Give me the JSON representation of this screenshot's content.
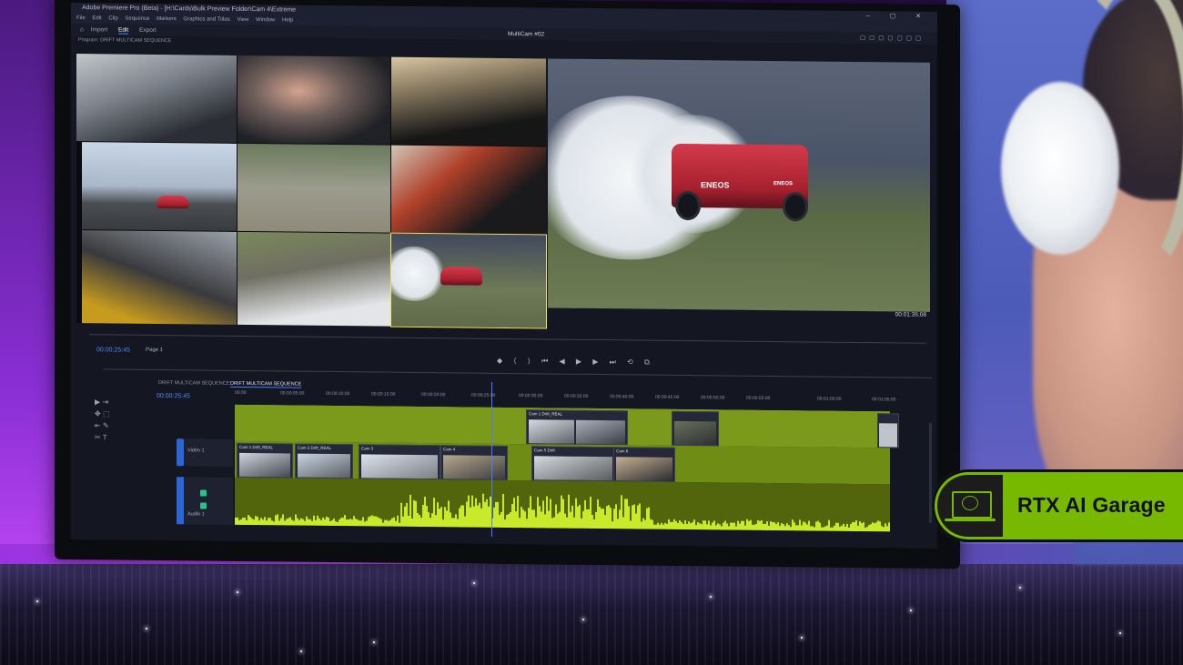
{
  "app": {
    "title_bar": "Adobe Premiere Pro (Beta) - [H:\\Cards\\Bulk Preview Folder\\Cam 4\\Extreme",
    "window_controls": "– ▢ ✕",
    "menu": [
      "File",
      "Edit",
      "Clip",
      "Sequence",
      "Markers",
      "Graphics and Titles",
      "View",
      "Window",
      "Help"
    ],
    "workspace_tabs": [
      "Import",
      "Edit",
      "Export"
    ],
    "active_tab": "Edit",
    "center_title": "MultiCam #02",
    "program_label": "Program: DRIFT MULTICAM SEQUENCE"
  },
  "program_monitor": {
    "timecode_left": "00:00:25:45",
    "page_info": "Page 1",
    "timecode_right": "00:01:35:08",
    "transport_icons": "◆ ⟨ ⟩ ⏮ ◀ ▶ ▶ ⏭ ⟲ ⧉"
  },
  "timeline": {
    "sequence_tab_left": "DRIFT MULTICAM SEQUENCE",
    "sequence_tab": "DRIFT MULTICAM SEQUENCE",
    "timecode": "00:00:25:45",
    "ruler": [
      "00:00",
      "00:00:05:00",
      "00:00:10:00",
      "00:00:15:00",
      "00:00:20:00",
      "00:00:25:00",
      "00:00:30:00",
      "00:00:35:00",
      "00:00:40:00",
      "00:00:45:00",
      "00:00:50:00",
      "00:00:55:00",
      "00:01:00:00",
      "00:01:05:00"
    ],
    "video_track": "Video 1",
    "audio_track": "Audio 1",
    "clip_labels": [
      "Cam 1 Drift_REAL",
      "Cam 2 Drift_REAL",
      "Cam 3",
      "Cam 4",
      "Cam 5 Drift",
      "Cam 6",
      "Cam 1 Drift_REAL"
    ]
  },
  "tools": [
    "▶",
    "⇥",
    "✥",
    "⬚",
    "⇤",
    "✎",
    "✂",
    "T"
  ],
  "badge": {
    "text": "RTX AI Garage",
    "icon": "laptop-palette-icon"
  },
  "main_view_sponsors": [
    "ENEOS",
    "ENEOS"
  ],
  "colors": {
    "accent_green": "#76b900",
    "timeline_blue": "#4f8bff",
    "track_green": "#7b9a1c"
  }
}
